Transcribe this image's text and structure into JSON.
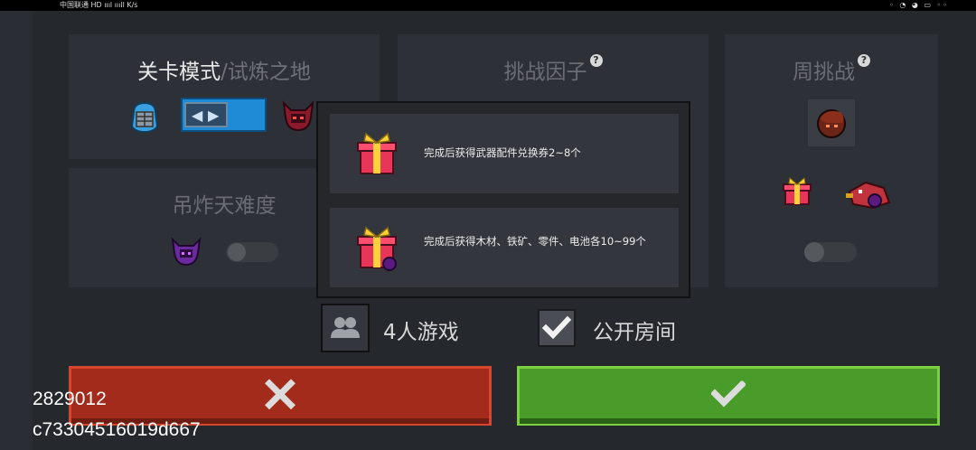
{
  "status_bar": {
    "carrier": "中国联通 HD  ıııl ıııll  K/s",
    "right_icons": "◦ ◔ ◕ ▭ ◦◦"
  },
  "mode_card": {
    "title": "关卡模式",
    "subtitle": "/试炼之地"
  },
  "hell_card": {
    "title": "吊炸天难度"
  },
  "factor_card": {
    "title": "挑战因子"
  },
  "weekly_card": {
    "title": "周挑战"
  },
  "popup": {
    "rewards": [
      {
        "text": "完成后获得武器配件兑换券2~8个",
        "icon": "gift-box-icon"
      },
      {
        "text": "完成后获得木材、铁矿、零件、电池各10~99个",
        "icon": "gift-box-badge-icon"
      }
    ]
  },
  "options": {
    "players_label": "4人游戏",
    "public_label": "公开房间",
    "public_checked": true
  },
  "overlay": {
    "line1": "2829012",
    "line2": "c73304516019d667"
  },
  "colors": {
    "cancel": "#a32b1b",
    "confirm": "#4a9c2a",
    "toggle_blue": "#1f8ad6"
  }
}
